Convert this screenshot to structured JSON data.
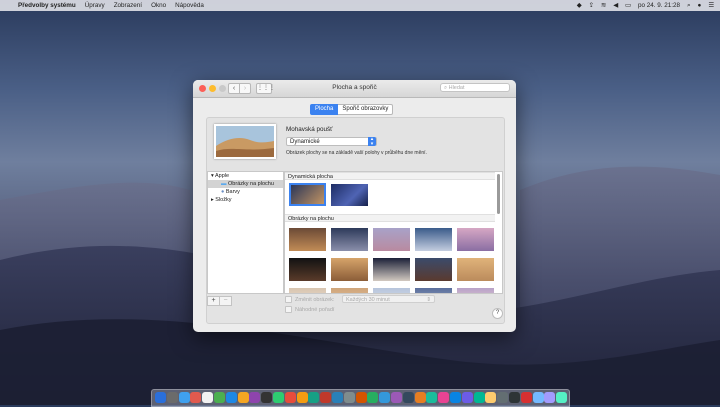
{
  "menubar": {
    "app_name": "Předvolby systému",
    "items": [
      "Úpravy",
      "Zobrazení",
      "Okno",
      "Nápověda"
    ],
    "datetime": "po 24. 9. 21:28"
  },
  "window": {
    "title": "Plocha a spořič",
    "search_placeholder": "Hledat",
    "tabs": [
      {
        "label": "Plocha",
        "selected": true
      },
      {
        "label": "Spořič obrazovky",
        "selected": false
      }
    ],
    "wallpaper_name": "Mohavská poušť",
    "mode_value": "Dynamické",
    "description": "Obrázek plochy se na základě vaší polohy v průběhu dne mění.",
    "sources": [
      {
        "label": "Apple",
        "expanded": true
      },
      {
        "label": "Obrázky na plochu",
        "selected": true
      },
      {
        "label": "Barvy"
      },
      {
        "label": "Složky",
        "expanded": false
      }
    ],
    "gallery_sections": [
      "Dynamická plocha",
      "Obrázky na plochu"
    ],
    "change_picture_label": "Změnit obrázek:",
    "interval_value": "Každých 30 minut",
    "random_order_label": "Náhodné pořadí",
    "add_label": "+",
    "remove_label": "−",
    "help_label": "?"
  },
  "colors": {
    "accent": "#3b82f0",
    "selected_row": "#d3d3d3"
  }
}
